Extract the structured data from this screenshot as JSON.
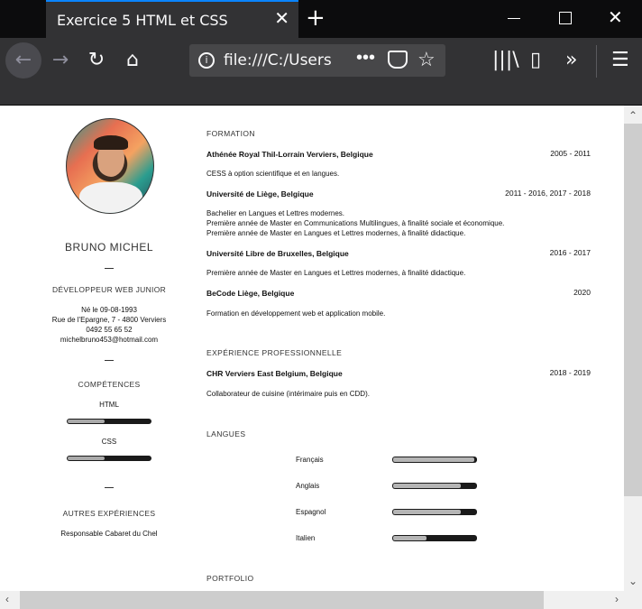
{
  "browser": {
    "tab_title": "Exercice 5 HTML et CSS",
    "tab_close": "✕",
    "new_tab": "+",
    "url": "file:///C:/Users",
    "url_more": "•••",
    "info_icon": "i",
    "star_icon": "☆",
    "back_icon": "←",
    "forward_icon": "→",
    "reload_icon": "↻",
    "home_icon": "⌂",
    "library_icon": "|||\\",
    "sidebar_icon": "▯",
    "overflow_icon": "»",
    "menu_icon": "☰",
    "win_close": "✕",
    "scroll_up": "⌃",
    "scroll_down": "⌄",
    "scroll_left": "‹",
    "scroll_right": "›"
  },
  "sidebar": {
    "name": "BRUNO MICHEL",
    "role": "DÉVELOPPEUR WEB JUNIOR",
    "birth": "Né le 09-08-1993",
    "address": "Rue de l'Epargne, 7 - 4800 Verviers",
    "phone": "0492 55 65 52",
    "email": "michelbruno453@hotmail.com",
    "skills_title": "COMPÉTENCES",
    "skills": [
      {
        "name": "HTML",
        "level": 0.45
      },
      {
        "name": "CSS",
        "level": 0.45
      }
    ],
    "other_title": "AUTRES EXPÉRIENCES",
    "other_item": "Responsable Cabaret du Chel"
  },
  "formation": {
    "title": "FORMATION",
    "entries": [
      {
        "school": "Athénée Royal Thil-Lorrain Verviers, Belgique",
        "dates": "2005 - 2011",
        "desc": "CESS à option scientifique et en langues."
      },
      {
        "school": "Université de Liège, Belgique",
        "dates": "2011 - 2016, 2017 - 2018",
        "desc1": "Bachelier en Langues et Lettres modernes.",
        "desc2": "Première année de Master en Communications Multilingues, à finalité sociale et économique.",
        "desc3": "Première année de Master en Langues et Lettres modernes, à finalité didactique."
      },
      {
        "school": "Université Libre de Bruxelles, Belgique",
        "dates": "2016 - 2017",
        "desc": "Première année de Master en Langues et Lettres modernes, à finalité didactique."
      },
      {
        "school": "BeCode Liège, Belgique",
        "dates": "2020",
        "desc": "Formation en développement web et application mobile."
      }
    ]
  },
  "experience": {
    "title": "EXPÉRIENCE PROFESSIONNELLE",
    "company": "CHR Verviers East Belgium, Belgique",
    "dates": "2018 - 2019",
    "desc": "Collaborateur de cuisine (intérimaire puis en CDD)."
  },
  "languages": {
    "title": "LANGUES",
    "items": [
      {
        "name": "Français",
        "level": 0.98
      },
      {
        "name": "Anglais",
        "level": 0.82
      },
      {
        "name": "Espagnol",
        "level": 0.82
      },
      {
        "name": "Italien",
        "level": 0.4
      }
    ]
  },
  "portfolio": {
    "title": "PORTFOLIO"
  }
}
